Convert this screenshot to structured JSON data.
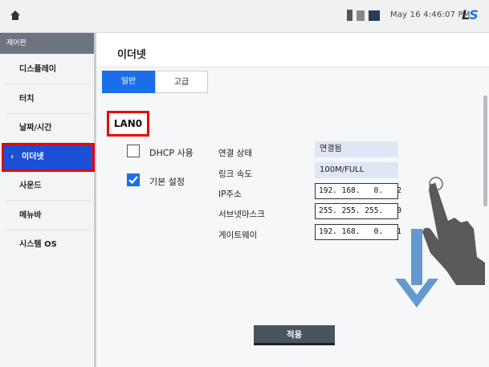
{
  "header": {
    "datetime": "May 16 4:46:07 PM",
    "logo": "LS",
    "icons": [
      "home-icon",
      "usb-icon",
      "sd-card-icon",
      "network-icon"
    ]
  },
  "sidebar": {
    "title": "제어판",
    "items": [
      {
        "label": "디스플레이"
      },
      {
        "label": "터치"
      },
      {
        "label": "날짜/시간"
      },
      {
        "label": "이더넷"
      },
      {
        "label": "사운드"
      },
      {
        "label": "메뉴바"
      },
      {
        "label": "시스템 OS"
      }
    ]
  },
  "main": {
    "title": "이더넷",
    "tabs": [
      {
        "label": "일반"
      },
      {
        "label": "고급"
      }
    ],
    "interface": "LAN0",
    "dhcp": {
      "label": "DHCP 사용",
      "checked": false
    },
    "default": {
      "label": "기본 설정",
      "checked": true
    },
    "fields": {
      "status_label": "연결 상태",
      "status_value": "연결됨",
      "speed_label": "링크 속도",
      "speed_value": "100M/FULL",
      "ip_label": "IP주소",
      "ip_value": "192. 168.   0.   2",
      "mask_label": "서브넷마스크",
      "mask_value": "255. 255. 255.   0",
      "gw_label": "게이트웨이",
      "gw_value": "192. 168.   0.   1"
    },
    "apply_label": "적용"
  },
  "colors": {
    "accent": "#1a6ee8",
    "highlight": "#e00000",
    "sidebar_active": "#1a4fd6"
  }
}
